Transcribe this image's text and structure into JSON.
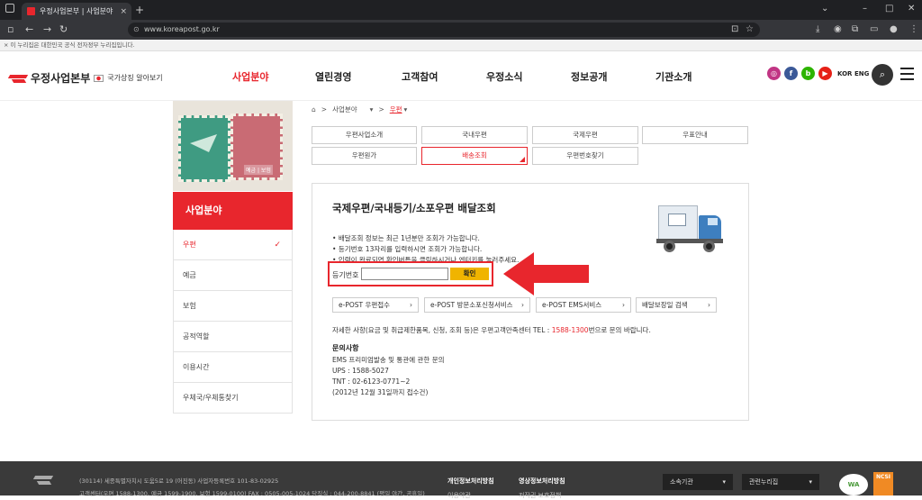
{
  "browser": {
    "tab_title": "우정사업본부 | 사업분야 | 우편",
    "tab_close": "×",
    "new_tab": "+",
    "url": "www.koreapost.go.kr",
    "notice": "이 누리집은 대한민국 공식 전자정부 누리집입니다."
  },
  "header": {
    "logo_text": "우정사업본부",
    "national_symbol": "국가상징 알아보기",
    "nav": [
      "사업분야",
      "열린경영",
      "고객참여",
      "우정소식",
      "정보공개",
      "기관소개"
    ],
    "sns": [
      "instagram",
      "facebook",
      "blog",
      "youtube"
    ],
    "lang_kor": "KOR",
    "lang_eng": "ENG"
  },
  "sidebar": {
    "stamp_label": "예금 | 보험",
    "title": "사업분야",
    "items": [
      "우편",
      "예금",
      "보험",
      "공적역할",
      "이용시간",
      "우체국/우체통찾기"
    ]
  },
  "breadcrumb": {
    "level1": "사업분야",
    "level2": "우편"
  },
  "subtabs": [
    "우편사업소개",
    "국내우편",
    "국제우편",
    "우표안내",
    "우편원가",
    "배송조회",
    "우편번호찾기"
  ],
  "tracking": {
    "title": "국제우편/국내등기/소포우편 배달조회",
    "notes": [
      "배달조회 정보는 최근 1년분만 조회가 가능합니다.",
      "등기번호 13자리를 입력하시면 조회가 가능합니다.",
      "입력이 완료되면 확인버튼을 클릭하시거나 엔터키를 눌러주세요."
    ],
    "input_label": "등기번호",
    "input_value": "",
    "confirm": "확인"
  },
  "services": [
    "e-POST 우편접수",
    "e-POST 방문소포신청서비스",
    "e-POST EMS서비스",
    "배달보장일 검색"
  ],
  "contact": {
    "text_before": "자세한 사항(요금 및 취급제한품목, 신청, 조회 등)은 우편고객만족센터 TEL : ",
    "tel": "1588-1300",
    "text_after": "번으로 문의 바랍니다."
  },
  "inquiry": {
    "title": "문의사항",
    "lines": [
      "EMS 프리미엄발송 및 통관에 관한 문의",
      "UPS : 1588-5027",
      "TNT : 02-6123-0771~2",
      "(2012년 12월 31일까지 접수건)"
    ]
  },
  "footer": {
    "address": "(30114) 세종특별자치시 도움5로 19 (어진동)    사업자등록번호 101-83-02925",
    "phones": "고객센터(우편 1588-1300, 예금 1599-1900, 보험 1599-0100)   FAX : 0505-005-1024   당직실 : 044-200-8841 (평일 야간, 공휴일)",
    "privacy": "개인정보처리방침",
    "video_privacy": "영상정보처리방침",
    "sub1": "이용약관",
    "sub2": "저작권 보호정책",
    "select1": "소속기관",
    "select2": "관련누리집",
    "badge1": "WA",
    "badge2": "NCSI"
  },
  "colors": {
    "brand": "#e8262d",
    "button": "#f0b400",
    "footer": "#3a3a3a"
  }
}
